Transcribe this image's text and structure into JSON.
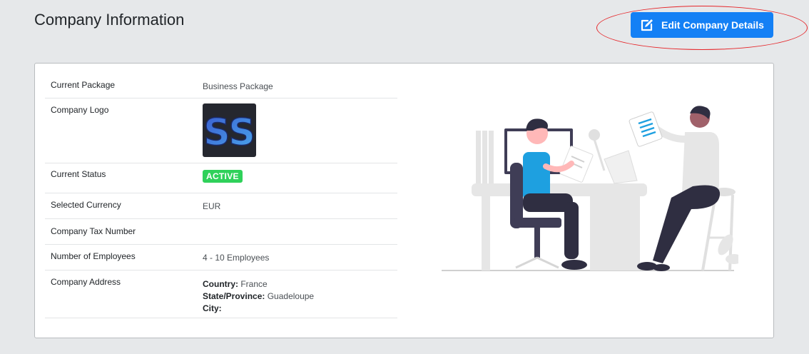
{
  "page": {
    "title": "Company Information"
  },
  "header": {
    "edit_button_label": "Edit Company Details",
    "edit_icon": "edit-icon"
  },
  "company": {
    "rows": [
      {
        "label": "Current Package",
        "value": "Business Package"
      },
      {
        "label": "Company Logo",
        "value": ""
      },
      {
        "label": "Current Status",
        "value": "ACTIVE"
      },
      {
        "label": "Selected Currency",
        "value": "EUR"
      },
      {
        "label": "Company Tax Number",
        "value": ""
      },
      {
        "label": "Number of Employees",
        "value": "4 - 10 Employees"
      },
      {
        "label": "Company Address",
        "value": ""
      }
    ],
    "logo_text": "SS",
    "address": {
      "country_label": "Country:",
      "country": "France",
      "state_label": "State/Province:",
      "state": "Guadeloupe",
      "city_label": "City:",
      "city": ""
    }
  },
  "colors": {
    "accent": "#1480f5",
    "status_active": "#2fd15a",
    "annotation": "#e6262a",
    "background": "#e6e8ea"
  }
}
